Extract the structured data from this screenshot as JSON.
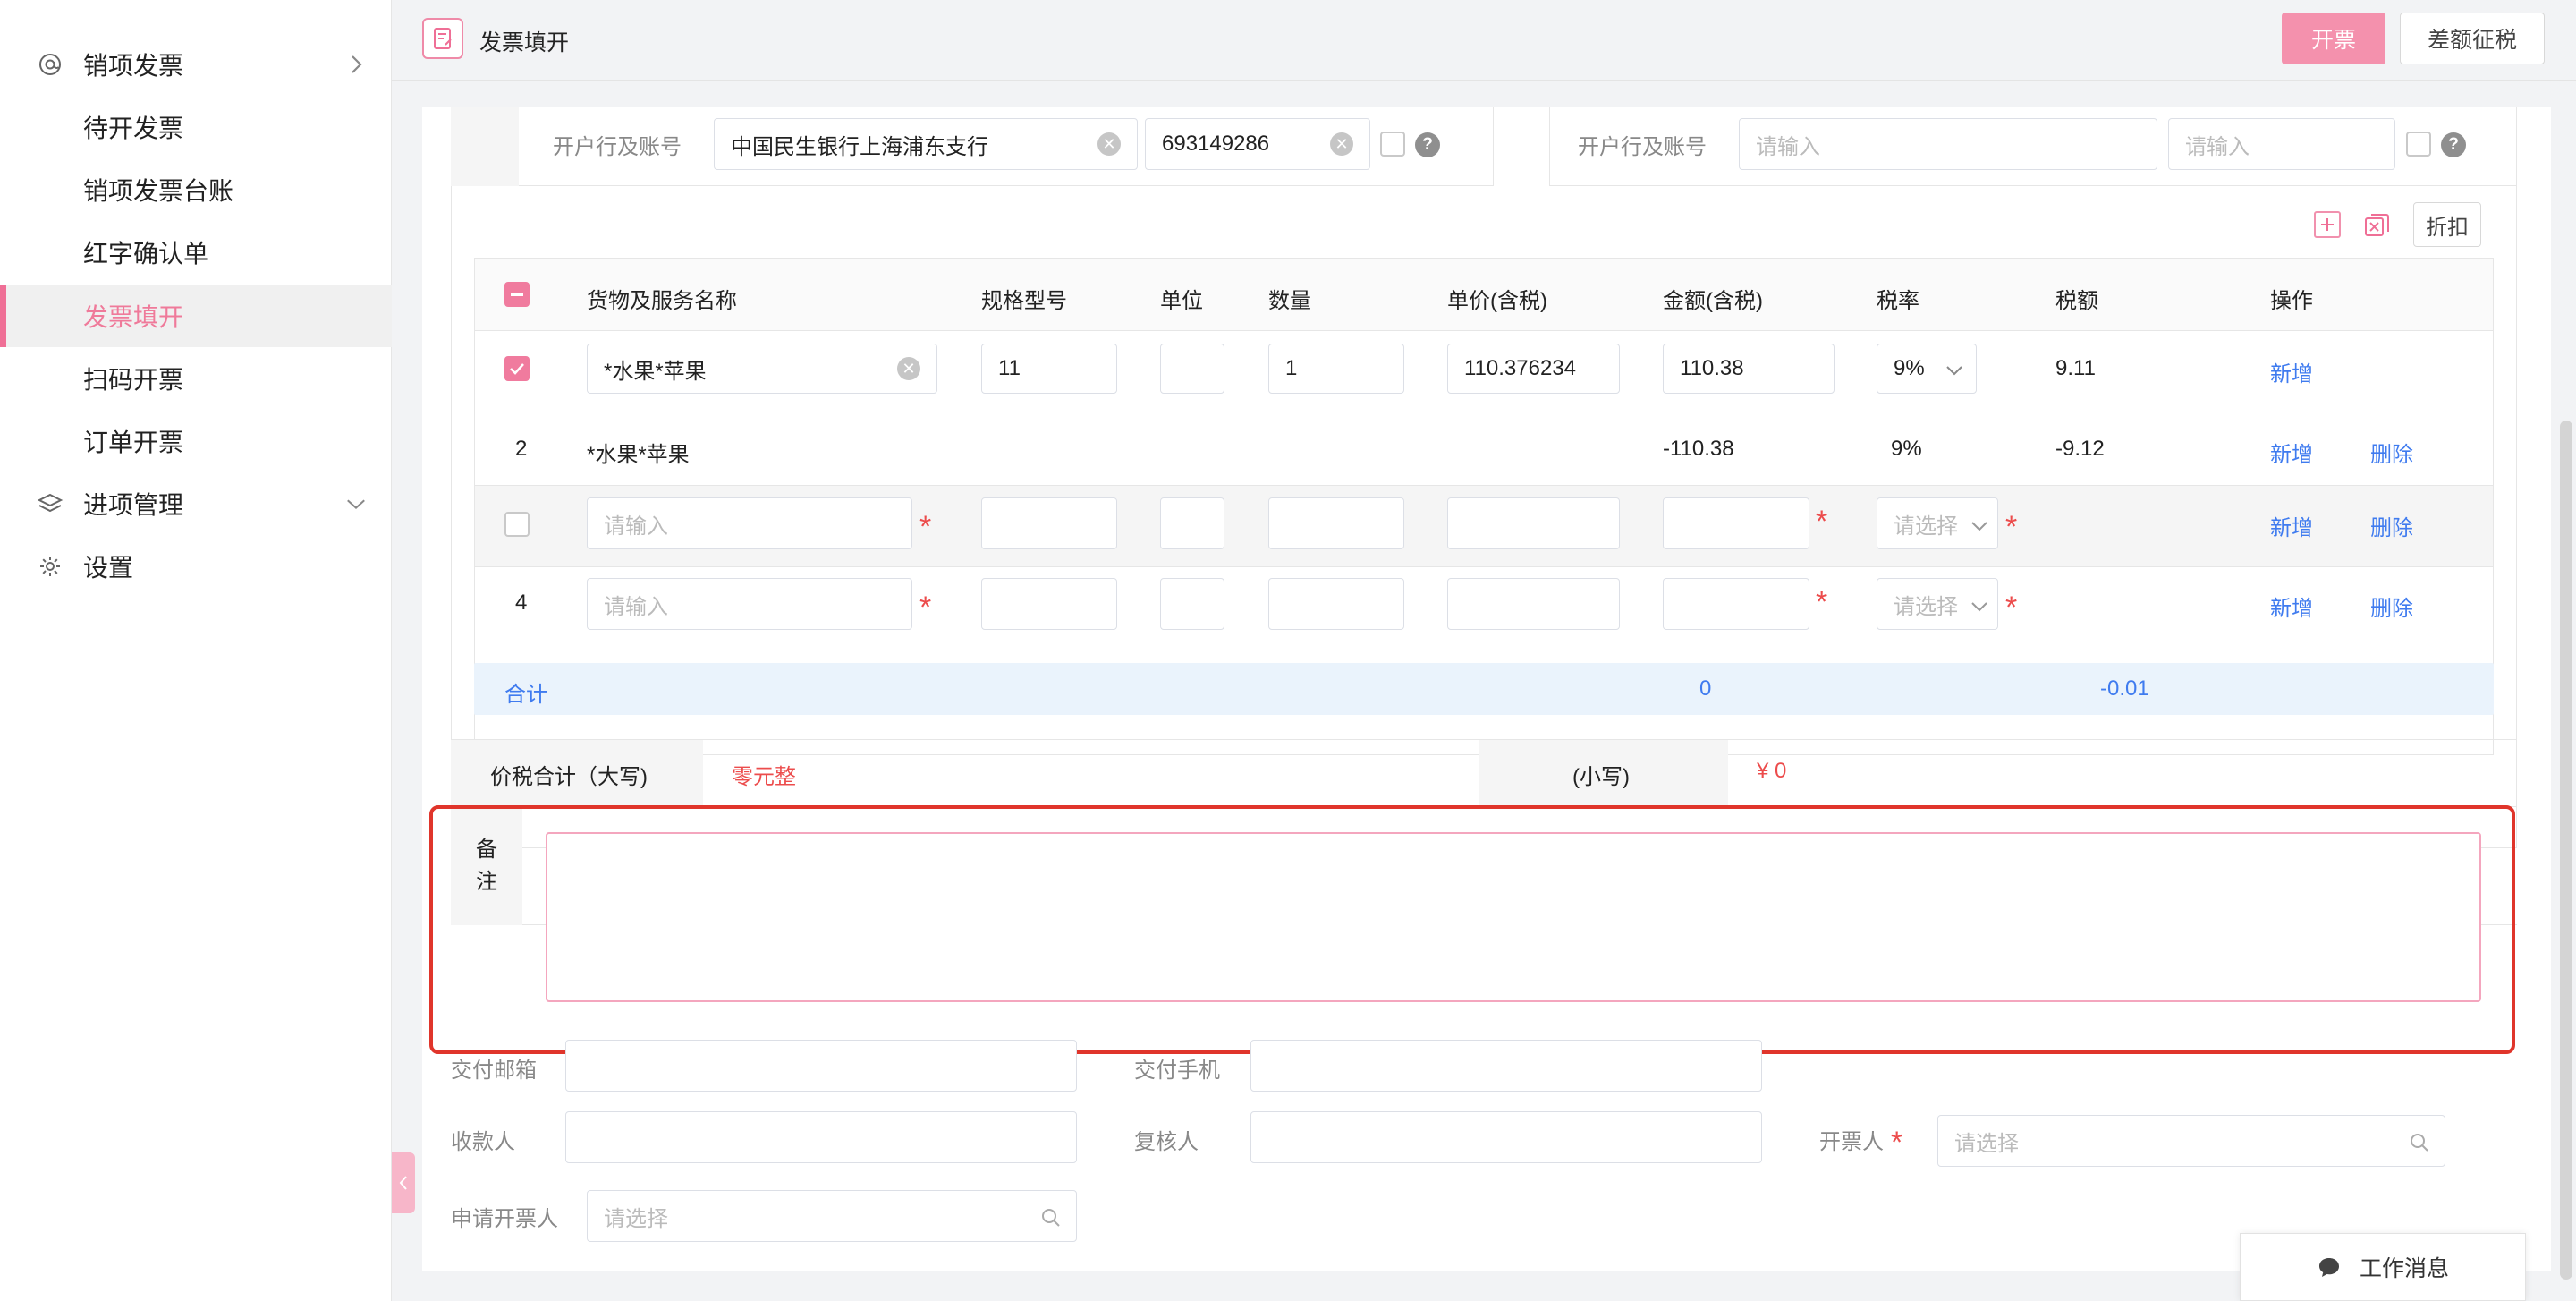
{
  "sidebar": {
    "items": [
      {
        "label": "销项发票",
        "icon": "at-icon",
        "chevron": "right"
      },
      {
        "label": "待开发票"
      },
      {
        "label": "销项发票台账"
      },
      {
        "label": "红字确认单"
      },
      {
        "label": "发票填开",
        "active": true
      },
      {
        "label": "扫码开票"
      },
      {
        "label": "订单开票"
      },
      {
        "label": "进项管理",
        "icon": "layers-icon",
        "chevron": "down"
      },
      {
        "label": "设置",
        "icon": "gear-icon"
      }
    ]
  },
  "header": {
    "title": "发票填开",
    "issue_button": "开票",
    "difference_tax_button": "差额征税"
  },
  "bank": {
    "seller_label": "开户行及账号",
    "seller_bank": "中国民生银行上海浦东支行",
    "seller_account": "693149286",
    "buyer_label": "开户行及账号",
    "buyer_bank_placeholder": "请输入",
    "buyer_account_placeholder": "请输入"
  },
  "toolbar": {
    "discount_button": "折扣"
  },
  "table": {
    "headers": [
      "货物及服务名称",
      "规格型号",
      "单位",
      "数量",
      "单价(含税)",
      "金额(含税)",
      "税率",
      "税额",
      "操作"
    ],
    "rows": [
      {
        "index": "",
        "checked": true,
        "name": "*水果*苹果",
        "spec": "11",
        "unit": "",
        "qty": "1",
        "price": "110.376234",
        "amount": "110.38",
        "rate": "9%",
        "tax": "9.11",
        "add": "新增",
        "delete": ""
      },
      {
        "index": "2",
        "name": "*水果*苹果",
        "amount": "-110.38",
        "rate": "9%",
        "tax": "-9.12",
        "add": "新增",
        "delete": "删除"
      },
      {
        "index": "",
        "checked": false,
        "name_placeholder": "请输入",
        "rate_placeholder": "请选择",
        "add": "新增",
        "delete": "删除"
      },
      {
        "index": "4",
        "name_placeholder": "请输入",
        "rate_placeholder": "请选择",
        "add": "新增",
        "delete": "删除"
      }
    ],
    "total_label": "合计",
    "total_amount": "0",
    "total_tax": "-0.01"
  },
  "summary": {
    "upper_label": "价税合计（大写)",
    "upper_value": "零元整",
    "lower_label": "(小写)",
    "lower_value": "¥ 0"
  },
  "remark": {
    "label_line1": "备",
    "label_line2": "注",
    "value": ""
  },
  "colors": {
    "accent": "#ef6f96",
    "link": "#3f7bef",
    "required": "#ec4c4c",
    "highlight": "#e0352b"
  },
  "form": {
    "email_label": "交付邮箱",
    "phone_label": "交付手机",
    "payee_label": "收款人",
    "reviewer_label": "复核人",
    "drawer_label": "开票人",
    "drawer_placeholder": "请选择",
    "applicant_label": "申请开票人",
    "applicant_placeholder": "请选择"
  },
  "message_button": "工作消息"
}
